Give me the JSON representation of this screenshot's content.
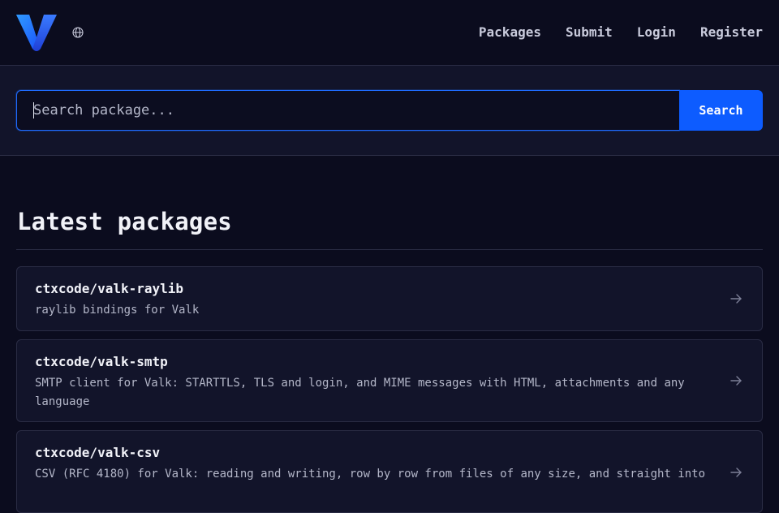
{
  "header": {
    "logo_icon": "valk-v-logo",
    "language_icon": "globe-icon",
    "nav": [
      {
        "label": "Packages"
      },
      {
        "label": "Submit"
      },
      {
        "label": "Login"
      },
      {
        "label": "Register"
      }
    ]
  },
  "search": {
    "placeholder": "Search package...",
    "value": "",
    "button_label": "Search"
  },
  "main": {
    "title": "Latest packages",
    "packages": [
      {
        "name": "ctxcode/valk-raylib",
        "description": "raylib bindings for Valk"
      },
      {
        "name": "ctxcode/valk-smtp",
        "description": "SMTP client for Valk: STARTTLS, TLS and login, and MIME messages with HTML, attachments and any language"
      },
      {
        "name": "ctxcode/valk-csv",
        "description": "CSV (RFC 4180) for Valk: reading and writing, row by row from files of any size, and straight into"
      }
    ]
  },
  "colors": {
    "background": "#0b0c1e",
    "panel": "#12142a",
    "accent": "#0d5cff",
    "border": "#2a2c44"
  }
}
